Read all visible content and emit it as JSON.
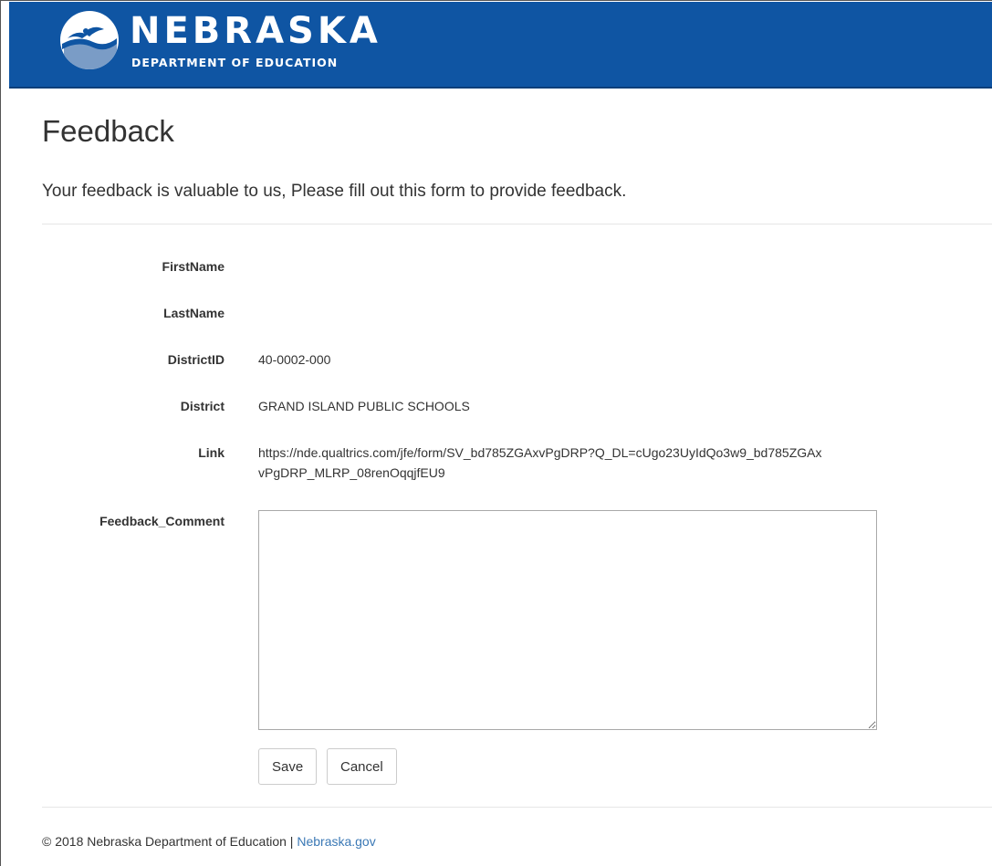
{
  "header": {
    "logo_title": "NEBRASKA",
    "logo_subtitle": "DEPARTMENT OF EDUCATION",
    "logo_icon": "nebraska-education-logo-icon",
    "colors": {
      "brand_blue": "#0f55a3"
    }
  },
  "page": {
    "title": "Feedback",
    "intro": "Your feedback is valuable to us, Please fill out this form to provide feedback."
  },
  "form": {
    "first_name_label": "FirstName",
    "first_name_value": "",
    "last_name_label": "LastName",
    "last_name_value": "",
    "district_id_label": "DistrictID",
    "district_id_value": "40-0002-000",
    "district_label": "District",
    "district_value": "GRAND ISLAND PUBLIC SCHOOLS",
    "link_label": "Link",
    "link_value": "https://nde.qualtrics.com/jfe/form/SV_bd785ZGAxvPgDRP?Q_DL=cUgo23UyIdQo3w9_bd785ZGAxvPgDRP_MLRP_08renOqqjfEU9",
    "comment_label": "Feedback_Comment",
    "comment_value": "",
    "save_label": "Save",
    "cancel_label": "Cancel"
  },
  "footer": {
    "copyright": "© 2018 Nebraska Department of Education | ",
    "link_text": "Nebraska.gov"
  }
}
